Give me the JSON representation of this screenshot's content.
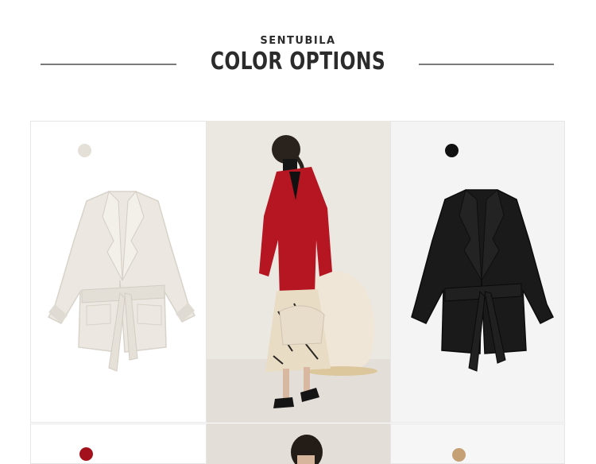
{
  "brand": "SENTUBILA",
  "title": "COLOR OPTIONS",
  "colors": {
    "ivory": "#e4e0d8",
    "black": "#111111",
    "red": "#a3121c",
    "camel": "#c4a074"
  }
}
